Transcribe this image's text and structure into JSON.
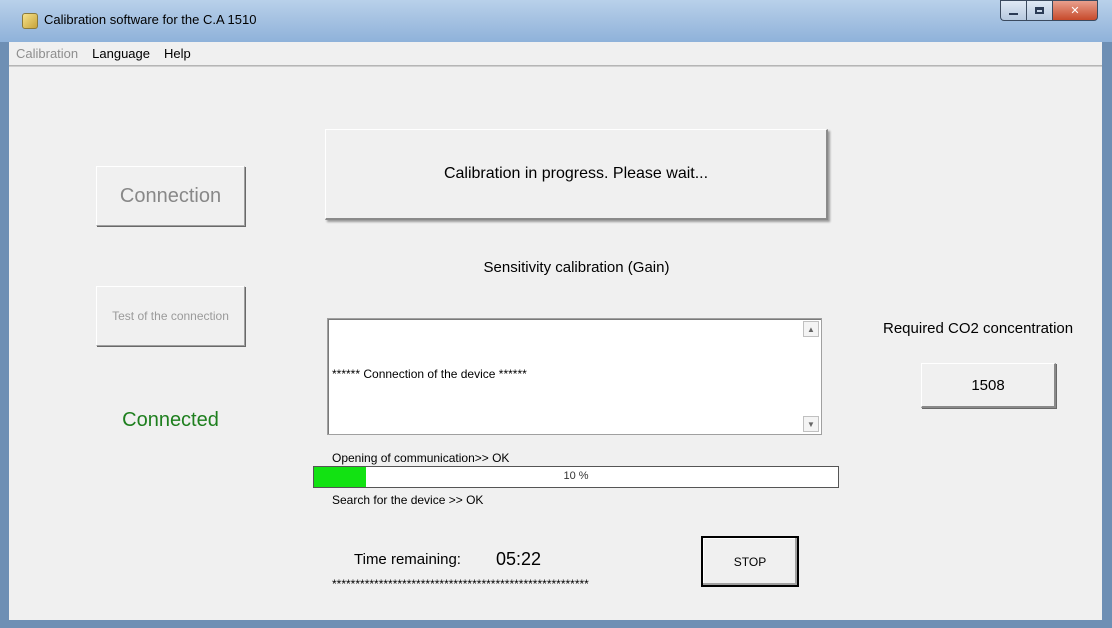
{
  "window": {
    "title": "Calibration software for the C.A 1510",
    "icon": "calibration-app-icon",
    "controls": [
      "minimize",
      "maximize",
      "close"
    ]
  },
  "menu": {
    "calibration": "Calibration",
    "language": "Language",
    "help": "Help"
  },
  "left": {
    "connection_button": "Connection",
    "test_button": "Test of the connection",
    "status": "Connected",
    "status_color": "#1e7f1e"
  },
  "center": {
    "message": "Calibration in progress.  Please wait...",
    "section_title": "Sensitivity calibration (Gain)",
    "log_lines": [
      "****** Connection of the device ******",
      "",
      "Opening of communication>> OK",
      "Search for the device >> OK",
      "",
      "*******************************************************"
    ],
    "progress_percent": 10,
    "progress_label": "10 %",
    "progress_color": "#12e212",
    "time_label": "Time remaining:",
    "time_value": "05:22",
    "stop_button": "STOP"
  },
  "right": {
    "required_label": "Required CO2 concentration",
    "concentration_value": "1508"
  }
}
